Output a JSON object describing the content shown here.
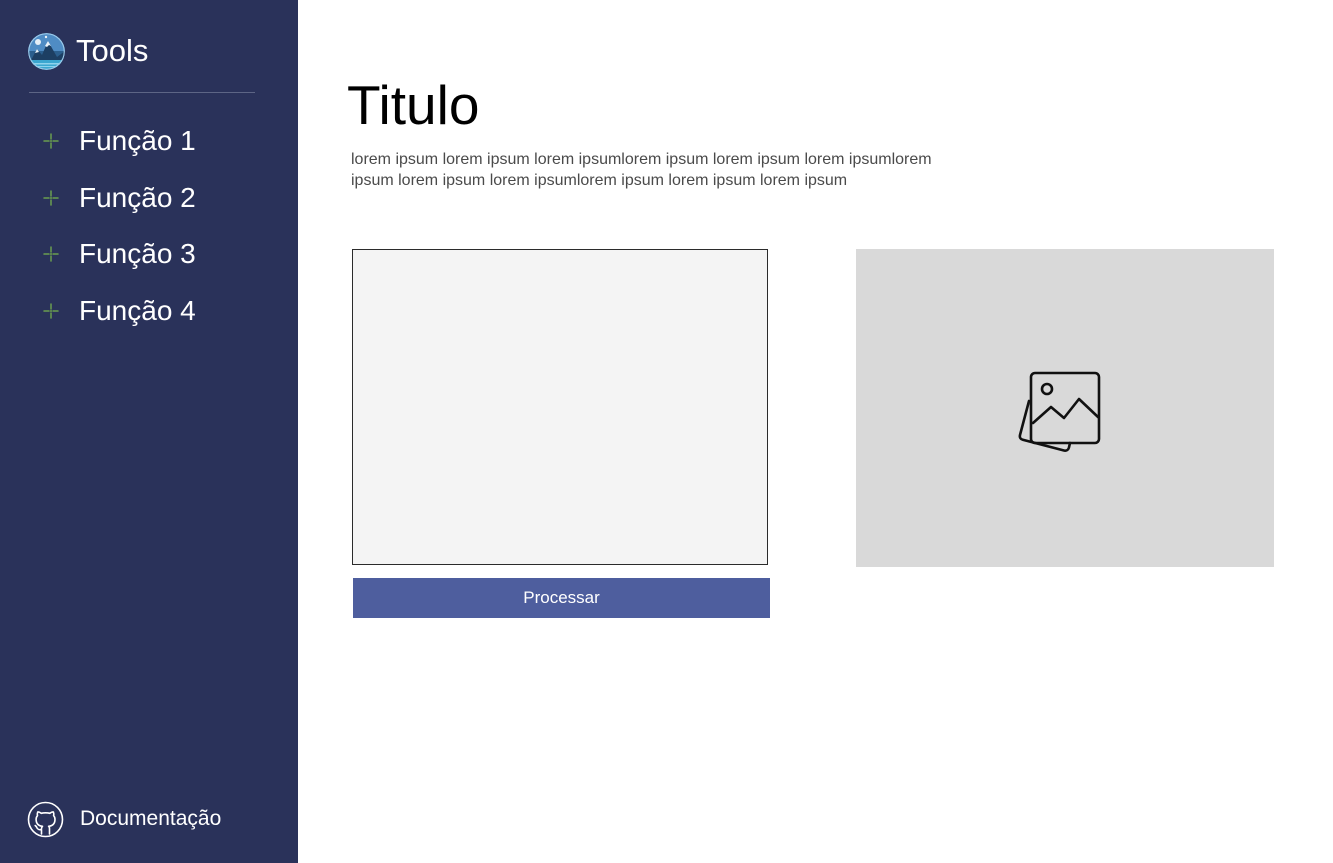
{
  "sidebar": {
    "brand": {
      "title": "Tools",
      "logo_icon": "mountain-logo-icon"
    },
    "nav_items": [
      {
        "label": "Função 1",
        "icon": "sparkle-icon"
      },
      {
        "label": "Função 2",
        "icon": "sparkle-icon"
      },
      {
        "label": "Função 3",
        "icon": "sparkle-icon"
      },
      {
        "label": "Função 4",
        "icon": "sparkle-icon"
      }
    ],
    "footer_link": {
      "label": "Documentação",
      "icon": "github-icon"
    }
  },
  "main": {
    "title": "Titulo",
    "description": "lorem ipsum lorem ipsum lorem ipsumlorem ipsum lorem ipsum lorem ipsumlorem ipsum lorem ipsum lorem ipsumlorem ipsum lorem ipsum lorem ipsum",
    "input_value": "",
    "process_button_label": "Processar",
    "image_placeholder_icon": "image-gallery-icon"
  },
  "colors": {
    "sidebar_bg": "#2a325a",
    "button_bg": "#4e5e9e",
    "input_bg": "#f4f4f4",
    "image_panel_bg": "#d9d9d9",
    "nav_icon_accent": "#6a9e4f"
  }
}
